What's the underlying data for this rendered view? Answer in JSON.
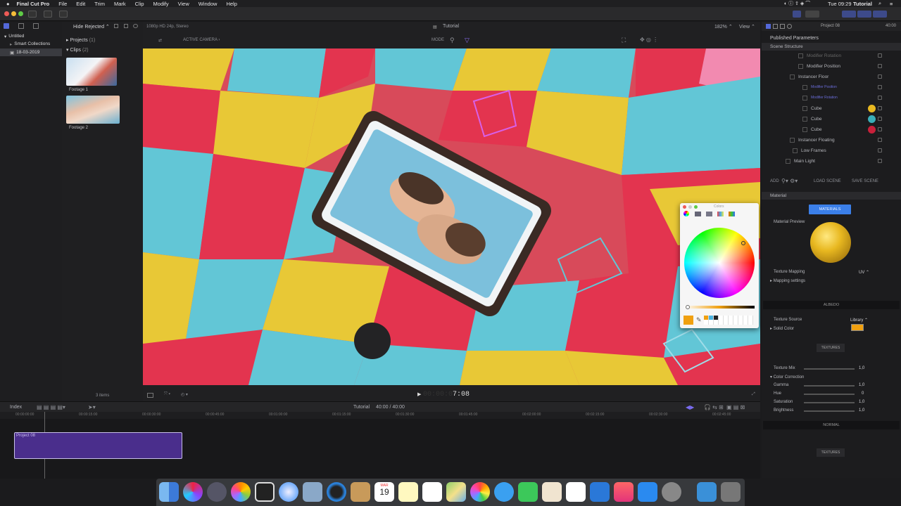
{
  "menubar": {
    "app": "Final Cut Pro",
    "items": [
      "File",
      "Edit",
      "Trim",
      "Mark",
      "Clip",
      "Modify",
      "View",
      "Window",
      "Help"
    ],
    "clock": "Tue 09:29",
    "user": "Tutorial"
  },
  "browser": {
    "filter": "Hide Rejected ⌃",
    "format": "1080p HD 24p, Stereo",
    "library": "Untitled",
    "smart_collections": "Smart Collections",
    "event": "18-03-2019",
    "projects_label": "Projects",
    "projects_count": "(1)",
    "clips_label": "Clips",
    "clips_count": "(2)",
    "clips": [
      {
        "name": "Footage 1"
      },
      {
        "name": "Footage 2"
      }
    ],
    "items_count": "3 items"
  },
  "viewer": {
    "title": "Tutorial",
    "zoom": "182% ⌃",
    "view": "View ⌃",
    "camera": "ACTIVE CAMERA",
    "mode": "MODE",
    "timecode_dim": "00:00:0",
    "timecode": "7:08"
  },
  "colorpicker": {
    "title": "Colors",
    "brightness": 0.95
  },
  "inspector": {
    "project": "Project 08",
    "duration": "40:00",
    "header": "Published Parameters",
    "scene_structure": "Scene Structure",
    "tree": [
      {
        "label": "Modifier Rotation"
      },
      {
        "label": "Modifier Position"
      },
      {
        "label": "Instancer Floor"
      },
      {
        "label": "Modifier Position"
      },
      {
        "label": "Modifier Rotation"
      },
      {
        "label": "Cube",
        "color": "#e8b820"
      },
      {
        "label": "Cube",
        "color": "#3aaeb8"
      },
      {
        "label": "Cube",
        "color": "#c8203a"
      },
      {
        "label": "Instancer Floating"
      },
      {
        "label": "Low Frames"
      },
      {
        "label": "Main Light"
      }
    ],
    "add": "ADD",
    "load_scene": "LOAD SCENE",
    "save_scene": "SAVE SCENE",
    "material": "Material",
    "materials_btn": "MATERIALS",
    "material_preview": "Material Preview",
    "texture_mapping": "Texture Mapping",
    "uv": "UV ⌃",
    "mapping_settings": "Mapping settings",
    "albedo": "ALBEDO",
    "texture_source": "Texture Source",
    "library": "Library ⌃",
    "solid_color": "Solid Color",
    "solid_color_value": "#f0a010",
    "textures": "TEXTURES",
    "texture_mix": "Texture Mix",
    "texture_mix_val": "1,0",
    "color_correction": "Color Correction",
    "gamma": "Gamma",
    "gamma_val": "1,0",
    "hue": "Hue",
    "hue_val": "0",
    "saturation": "Saturation",
    "saturation_val": "1,0",
    "brightness": "Brightness",
    "brightness_val": "1,0",
    "normal": "NORMAL",
    "textures2": "TEXTURES"
  },
  "timeline": {
    "index": "Index",
    "project_name": "Tutorial",
    "duration": "40:00 / 40:00",
    "ruler": [
      "00:00:00:00",
      "00:00:15:00",
      "00:00:30:00",
      "00:00:45:00",
      "00:01:00:00",
      "00:01:15:00",
      "00:01:30:00",
      "00:01:45:00",
      "00:02:00:00",
      "00:02:15:00",
      "00:02:30:00",
      "00:02:45:00"
    ],
    "clip": "Project 08"
  },
  "dock": {
    "calendar_month": "MAR",
    "calendar_day": "19"
  }
}
